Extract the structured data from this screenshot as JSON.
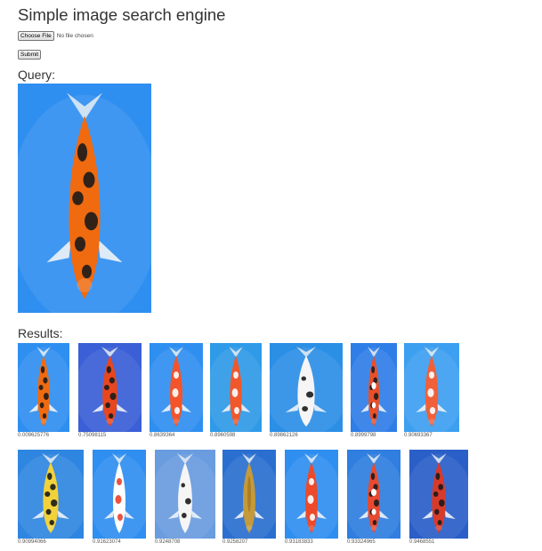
{
  "title": "Simple image search engine",
  "file_input": {
    "button_label": "Choose File",
    "status": "No file chosen"
  },
  "submit_label": "Submit",
  "query_label": "Query:",
  "results_label": "Results:",
  "query_image": {
    "bg": "#2f8ff0",
    "body": "#f06a10",
    "spot": "#1b1b1b",
    "pattern": "black-spotted-orange"
  },
  "results": [
    {
      "score": "0.009625776",
      "bg": "#2f8ff0",
      "body": "#f06a10",
      "spot": "#1b1b1b",
      "pattern": "black-spotted-orange"
    },
    {
      "score": "0.75098115",
      "bg": "#3a5fd6",
      "body": "#e8461e",
      "spot": "#1b1b1b",
      "pattern": "black-spotted-red"
    },
    {
      "score": "0.8639364",
      "bg": "#2f8ff0",
      "body": "#f3542a",
      "spot": "#ffffff",
      "pattern": "red-white"
    },
    {
      "score": "0.8960598",
      "bg": "#2f9be8",
      "body": "#f0582c",
      "spot": "#ffffff",
      "pattern": "red-white"
    },
    {
      "score": "0.89862126",
      "bg": "#2c8fe6",
      "body": "#f5f5f5",
      "spot": "#1b1b1b",
      "pattern": "white-black"
    },
    {
      "score": "0.8999798",
      "bg": "#2f7ee8",
      "body": "#e8502a",
      "spot": "#1b1b1b",
      "pattern": "red-white-black"
    },
    {
      "score": "0.90693367",
      "bg": "#3d9ff0",
      "body": "#f0603a",
      "spot": "#ffffff",
      "pattern": "red-white"
    },
    {
      "score": "0.90994066",
      "bg": "#2f86e0",
      "body": "#f2d23a",
      "spot": "#1b1b1b",
      "pattern": "yellow-black"
    },
    {
      "score": "0.91623074",
      "bg": "#2f8ff0",
      "body": "#ffffff",
      "spot": "#e8402a",
      "pattern": "white-red"
    },
    {
      "score": "0.9248708",
      "bg": "#6a9ce0",
      "body": "#f5f5f5",
      "spot": "#1b1b1b",
      "pattern": "white-black"
    },
    {
      "score": "0.9258207",
      "bg": "#2a6fd0",
      "body": "#c49a3a",
      "spot": "#a87a22",
      "pattern": "gold"
    },
    {
      "score": "0.93183833",
      "bg": "#2f8ff0",
      "body": "#ec4a2a",
      "spot": "#ffffff",
      "pattern": "red-white"
    },
    {
      "score": "0.93324965",
      "bg": "#2f7ee0",
      "body": "#e84a30",
      "spot": "#1b1b1b",
      "pattern": "red-white-black"
    },
    {
      "score": "0.9468551",
      "bg": "#2a5fc8",
      "body": "#d83a2a",
      "spot": "#1b1b1b",
      "pattern": "red-black"
    }
  ]
}
